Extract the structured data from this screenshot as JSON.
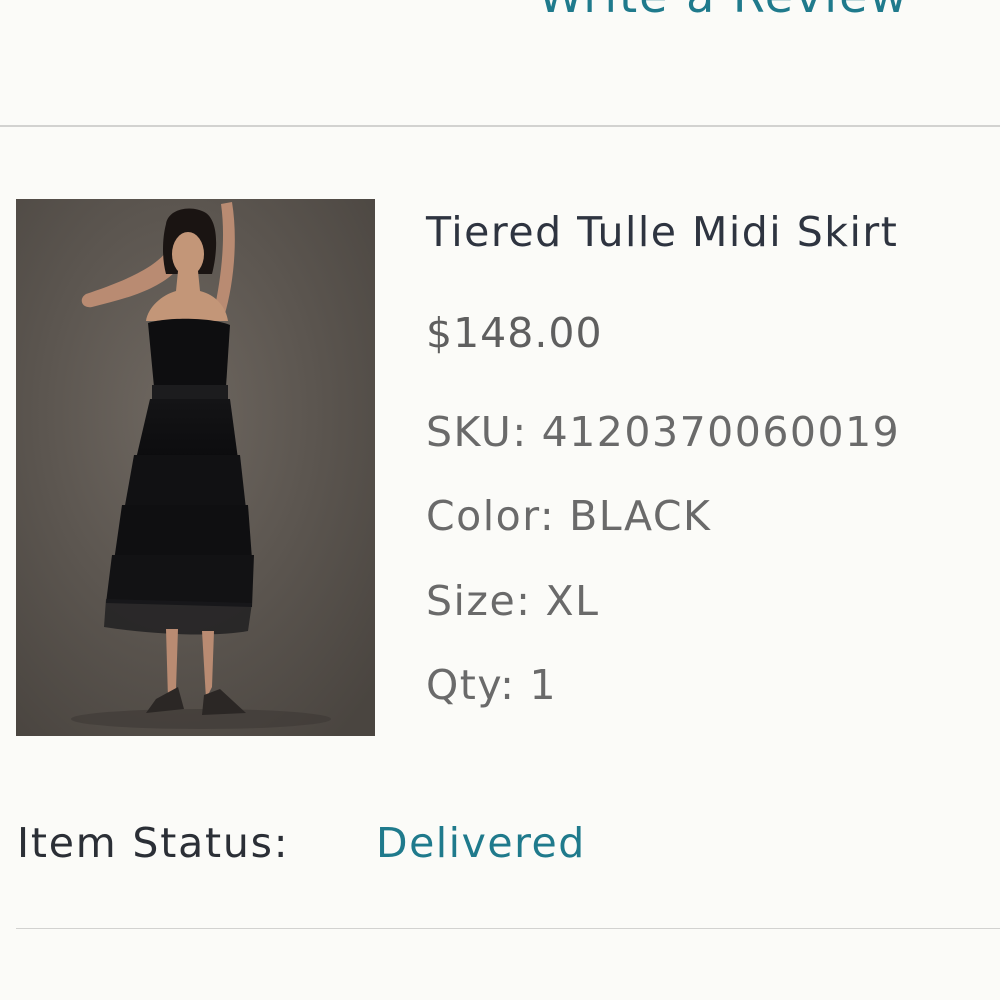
{
  "review": {
    "link_label": "Write a Review"
  },
  "product": {
    "name": "Tiered Tulle Midi Skirt",
    "price": "$148.00",
    "sku_label": "SKU:",
    "sku_value": "4120370060019",
    "color_label": "Color:",
    "color_value": "BLACK",
    "size_label": "Size:",
    "size_value": "XL",
    "qty_label": "Qty:",
    "qty_value": "1"
  },
  "status": {
    "label": "Item Status:",
    "value": "Delivered"
  },
  "colors": {
    "accent": "#1f7a8c",
    "title_text": "#2e3440",
    "detail_text": "#6a6a6a",
    "divider": "#d2d2d0",
    "background": "#fbfbf8"
  }
}
